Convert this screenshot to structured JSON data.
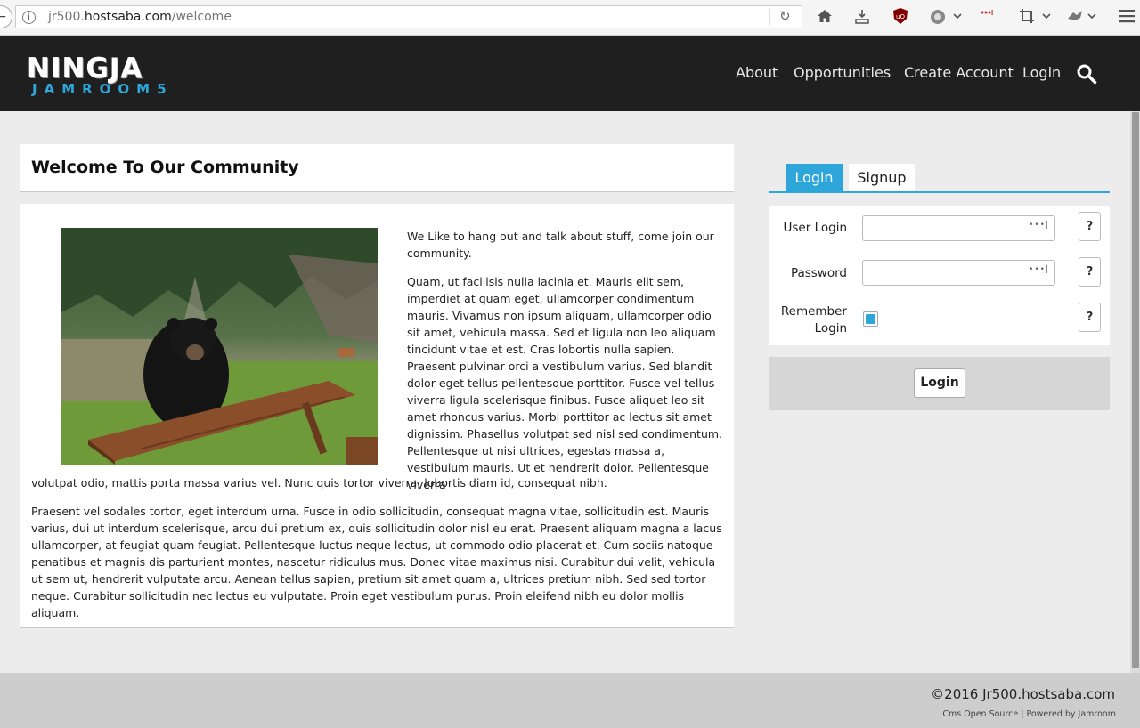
{
  "browser": {
    "url_prefix": "jr500.",
    "url_host": "hostsaba.com",
    "url_path": "/welcome",
    "info_icon": "i",
    "toolbar_icons": [
      "home-icon",
      "download-icon",
      "ublock-icon",
      "settings-icon",
      "lastpass-icon",
      "crop-icon",
      "extension-icon",
      "menu-icon"
    ]
  },
  "header": {
    "logo_top": "NINGJA",
    "logo_bottom": "JAMROOM5",
    "nav": {
      "about": "About",
      "opportunities": "Opportunities",
      "create_account": "Create Account",
      "login": "Login"
    }
  },
  "main": {
    "title": "Welcome To Our Community",
    "p1": "We Like to hang out and talk about stuff, come join our community.",
    "p2": "Quam, ut facilisis nulla lacinia et. Mauris elit sem, imperdiet at quam eget, ullamcorper condimentum mauris. Vivamus non ipsum aliquam, ullamcorper odio sit amet, vehicula massa. Sed et ligula non leo aliquam tincidunt vitae et est. Cras lobortis nulla sapien. Praesent pulvinar orci a vestibulum varius. Sed blandit dolor eget tellus pellentesque porttitor. Fusce vel tellus viverra ligula scelerisque finibus. Fusce aliquet leo sit amet rhoncus varius. Morbi porttitor ac lectus sit amet dignissim. Phasellus volutpat sed nisl sed condimentum. Pellentesque ut nisi ultrices, egestas massa a, vestibulum mauris. Ut et hendrerit dolor. Pellentesque viverra",
    "p2_tail": "volutpat odio, mattis porta massa varius vel. Nunc quis tortor viverra, lobortis diam id, consequat nibh.",
    "p3": "Praesent vel sodales tortor, eget interdum urna. Fusce in odio sollicitudin, consequat magna vitae, sollicitudin est. Mauris varius, dui ut interdum scelerisque, arcu dui pretium ex, quis sollicitudin dolor nisl eu erat. Praesent aliquam magna a lacus ullamcorper, at feugiat quam feugiat. Pellentesque luctus neque lectus, ut commodo odio placerat et. Cum sociis natoque penatibus et magnis dis parturient montes, nascetur ridiculus mus. Donec vitae maximus nisi. Curabitur dui velit, vehicula ut sem ut, hendrerit vulputate arcu. Aenean tellus sapien, pretium sit amet quam a, ultrices pretium nibh. Sed sed tortor neque. Curabitur sollicitudin nec lectus eu vulputate. Proin eget vestibulum purus. Proin eleifend nibh eu dolor mollis aliquam."
  },
  "login_panel": {
    "tab_login": "Login",
    "tab_signup": "Signup",
    "user_login_label": "User Login",
    "password_label": "Password",
    "remember_label_line1": "Remember",
    "remember_label_line2": "Login",
    "remember_checked": true,
    "help": "?",
    "submit": "Login",
    "input_indicator": "•••|"
  },
  "footer": {
    "copyright": "©2016 Jr500.hostsaba.com",
    "powered": "Cms Open Source | Powered by Jamroom"
  },
  "colors": {
    "accent": "#2ea6d9",
    "header_bg": "#1f1f1f",
    "page_bg": "#ececec"
  }
}
